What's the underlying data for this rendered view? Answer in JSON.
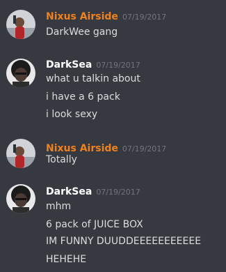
{
  "colors": {
    "background": "#36393f",
    "nixus_name": "#f0821e",
    "darksea_name": "#ffffff",
    "message_text": "#dcddde",
    "timestamp": "#72767d"
  },
  "messages": [
    {
      "author": "Nixus Airside",
      "timestamp": "07/19/2017",
      "avatar_icon": "person-portrait-avatar",
      "lines": [
        "DarkWee gang"
      ]
    },
    {
      "author": "DarkSea",
      "timestamp": "07/19/2017",
      "avatar_icon": "afro-character-avatar",
      "lines": [
        "what u talkin about",
        "i have a 6 pack",
        "i look sexy"
      ]
    },
    {
      "author": "Nixus Airside",
      "timestamp": "07/19/2017",
      "avatar_icon": "person-portrait-avatar",
      "lines": [
        "Totally"
      ]
    },
    {
      "author": "DarkSea",
      "timestamp": "07/19/2017",
      "avatar_icon": "afro-character-avatar",
      "lines": [
        "mhm",
        "6 pack of JUICE BOX",
        "IM FUNNY DUUDDEEEEEEEEEEE",
        "HEHEHE"
      ]
    }
  ]
}
